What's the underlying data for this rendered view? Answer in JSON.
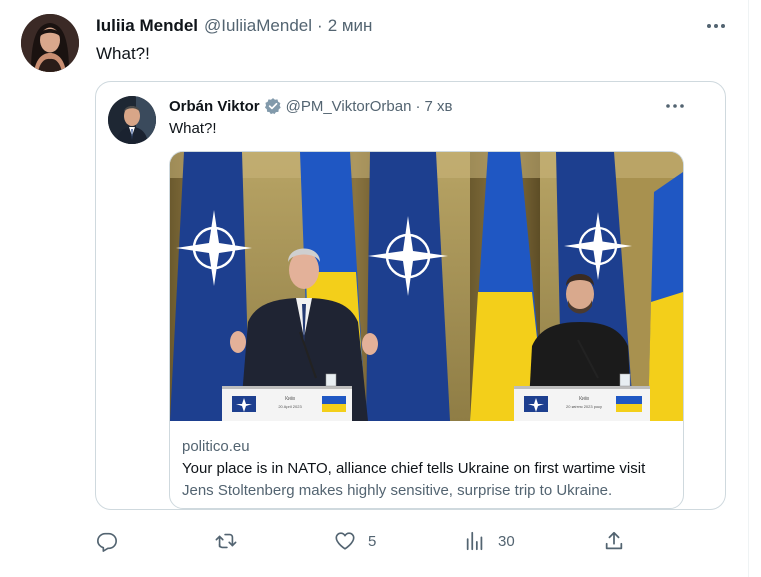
{
  "tweet": {
    "author_name": "Iuliia Mendel",
    "handle": "@IuliiaMendel",
    "separator": "·",
    "time": "2 мин",
    "text": "What?!"
  },
  "quoted": {
    "author_name": "Orbán Viktor",
    "handle": "@PM_ViktorOrban",
    "separator": "·",
    "time": "7 хв",
    "text": "What?!",
    "card": {
      "domain": "politico.eu",
      "title": "Your place is in NATO, alliance chief tells Ukraine on first wartime visit",
      "description": "Jens Stoltenberg makes highly sensitive, surprise trip to Ukraine.",
      "podium_left_text": "Київ",
      "podium_left_date": "20 April 2023",
      "podium_right_text": "Київ",
      "podium_right_date": "20 квітня 2023 року"
    }
  },
  "actions": {
    "reply_count": "",
    "retweet_count": "",
    "like_count": "5",
    "views_count": "30"
  },
  "colors": {
    "text": "#0f1419",
    "secondary": "#536471",
    "border": "#cfd9de",
    "verified": "#829aab",
    "nato_blue": "#1d3f8f",
    "ukraine_blue": "#1f57c3",
    "ukraine_yellow": "#f3cf1a"
  },
  "icons": [
    "more-icon",
    "verified-badge-icon",
    "reply-icon",
    "retweet-icon",
    "like-icon",
    "views-icon",
    "share-icon"
  ]
}
